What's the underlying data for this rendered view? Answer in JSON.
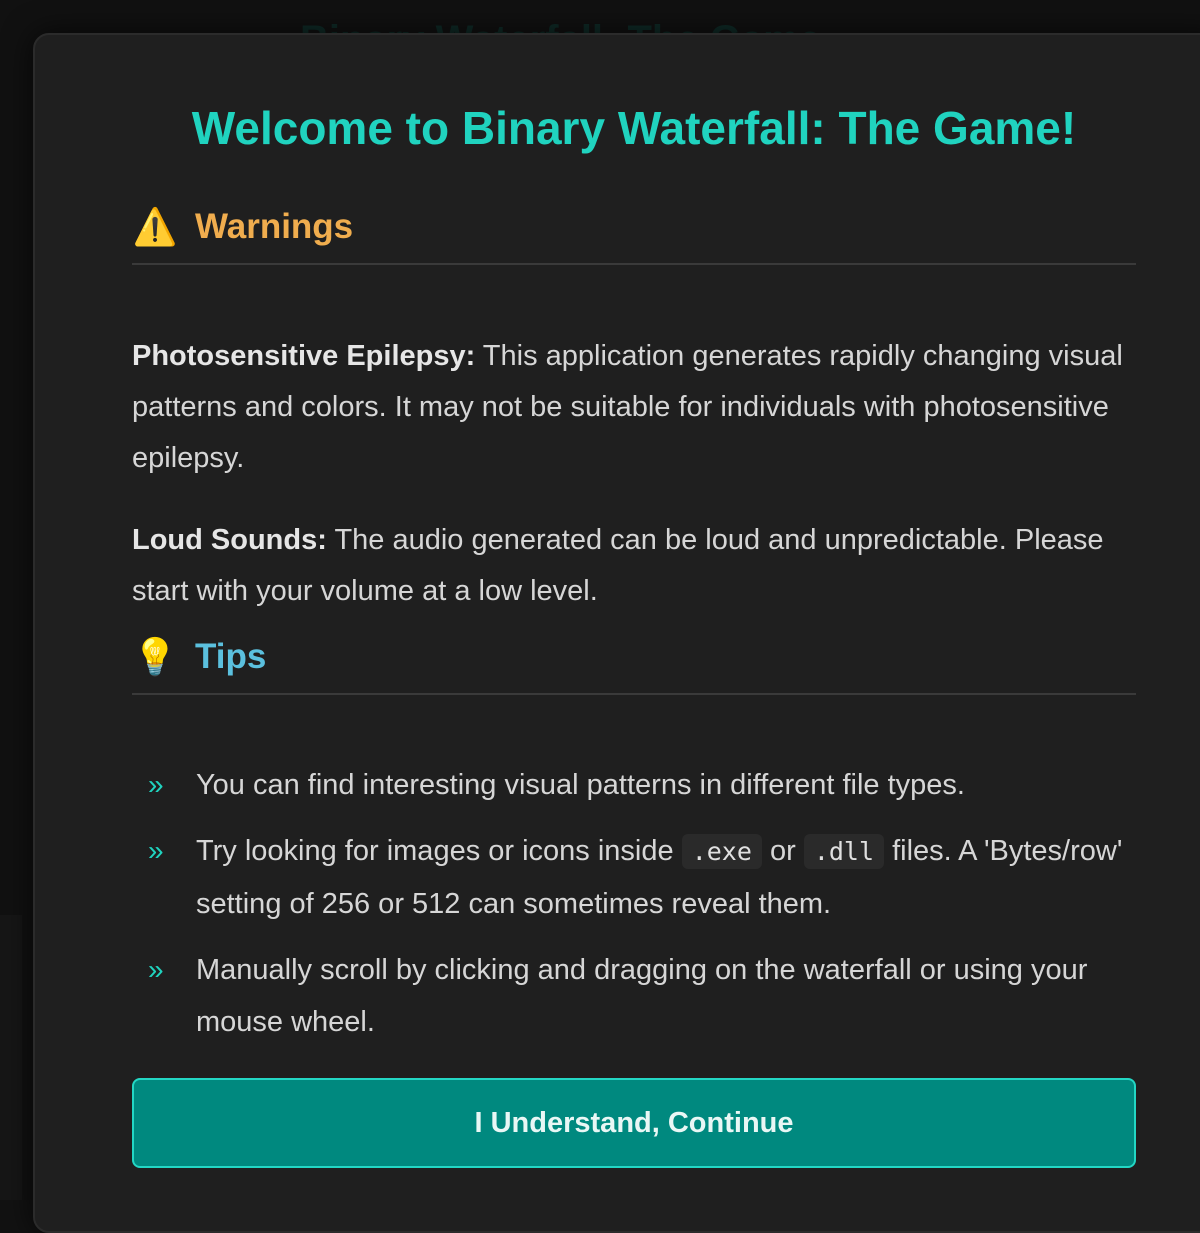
{
  "background": {
    "title": "Binary Waterfall: The Game"
  },
  "modal": {
    "title": "Welcome to Binary Waterfall: The Game!",
    "warnings": {
      "icon": "warning-icon",
      "emoji": "⚠️",
      "heading": "Warnings",
      "color": "#f0ad4e",
      "items": [
        {
          "label": "Photosensitive Epilepsy:",
          "text": " This application generates rapidly changing visual patterns and colors. It may not be suitable for individuals with photosensitive epilepsy."
        },
        {
          "label": "Loud Sounds:",
          "text": " The audio generated can be loud and unpredictable. Please start with your volume at a low level."
        }
      ]
    },
    "tips": {
      "icon": "lightbulb-icon",
      "emoji": "💡",
      "heading": "Tips",
      "color": "#5bc0de",
      "bullet": "»",
      "items": [
        {
          "text": "You can find interesting visual patterns in different file types."
        },
        {
          "text_before": "Try looking for images or icons inside ",
          "code1": ".exe",
          "text_mid": " or ",
          "code2": ".dll",
          "text_after": " files. A 'Bytes/row' setting of 256 or 512 can sometimes reveal them."
        },
        {
          "text": "Manually scroll by clicking and dragging on the waterfall or using your mouse wheel."
        }
      ]
    },
    "continue_label": "I Understand, Continue"
  },
  "colors": {
    "accent": "#20d3bf",
    "button_bg": "#00897f",
    "modal_bg": "#1f1f1f"
  }
}
